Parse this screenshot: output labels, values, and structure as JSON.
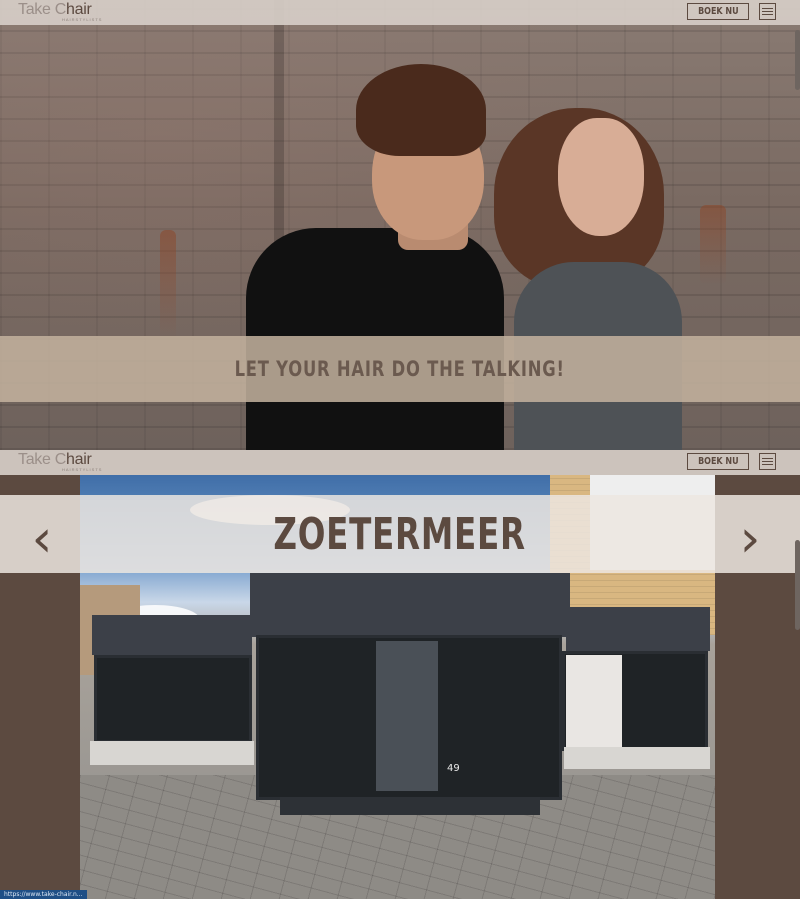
{
  "header": {
    "logo_main": "Take C",
    "logo_accent": "hair",
    "logo_sub": "HAIRSTYLISTS",
    "book_label": "BOEK NU"
  },
  "hero": {
    "tagline": "LET YOUR HAIR DO THE TALKING!"
  },
  "location": {
    "city": "ZOETERMEER",
    "prev_arrow": "‹",
    "next_arrow": "›",
    "door_number": "49"
  },
  "status_bar": {
    "url": "https://www.take-chair.n..."
  },
  "colors": {
    "brand_brown": "#5c4a40",
    "banner_beige": "#c4b29e",
    "header_grey": "#d6cdc7"
  },
  "icons": {
    "menu": "hamburger-icon",
    "prev": "chevron-left-icon",
    "next": "chevron-right-icon"
  }
}
